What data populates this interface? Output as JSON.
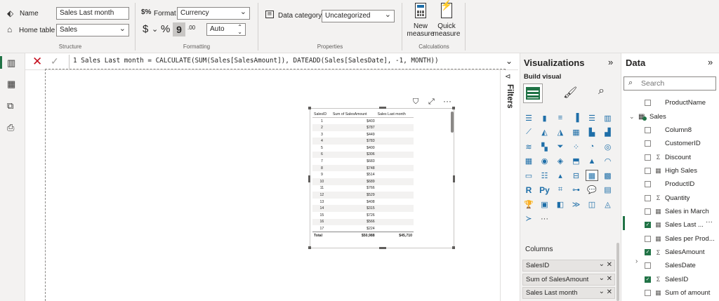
{
  "ribbon": {
    "structure": {
      "name_label": "Name",
      "name_value": "Sales Last month",
      "home_table_label": "Home table",
      "home_table_value": "Sales",
      "group_label": "Structure"
    },
    "formatting": {
      "format_label": "Format",
      "format_value": "Currency",
      "currency_symbol": "$",
      "percent_symbol": "%",
      "comma_symbol": "9",
      "decimals_symbol": ".00",
      "decimal_places_value": "Auto",
      "group_label": "Formatting"
    },
    "properties": {
      "data_category_label": "Data category",
      "data_category_value": "Uncategorized",
      "group_label": "Properties"
    },
    "calculations": {
      "new_measure_line1": "New",
      "new_measure_line2": "measure",
      "quick_measure_line1": "Quick",
      "quick_measure_line2": "measure",
      "group_label": "Calculations"
    }
  },
  "formula_bar": {
    "line_number": "1",
    "formula": "Sales Last month = CALCULATE(SUM(Sales[SalesAmount]), DATEADD(Sales[SalesDate], -1, MONTH))"
  },
  "filters_label": "Filters",
  "table_visual": {
    "headers": [
      "SalesID",
      "Sum of SalesAmount",
      "Sales Last month"
    ],
    "rows": [
      [
        "1",
        "$403",
        ""
      ],
      [
        "2",
        "$787",
        ""
      ],
      [
        "3",
        "$449",
        ""
      ],
      [
        "4",
        "$783",
        ""
      ],
      [
        "5",
        "$400",
        ""
      ],
      [
        "6",
        "$306",
        ""
      ],
      [
        "7",
        "$683",
        ""
      ],
      [
        "8",
        "$748",
        ""
      ],
      [
        "9",
        "$514",
        ""
      ],
      [
        "10",
        "$689",
        ""
      ],
      [
        "11",
        "$766",
        ""
      ],
      [
        "12",
        "$529",
        ""
      ],
      [
        "13",
        "$408",
        ""
      ],
      [
        "14",
        "$315",
        ""
      ],
      [
        "15",
        "$726",
        ""
      ],
      [
        "16",
        "$566",
        ""
      ],
      [
        "17",
        "$224",
        ""
      ]
    ],
    "total": [
      "Total",
      "$50,988",
      "$45,710"
    ]
  },
  "visualizations": {
    "title": "Visualizations",
    "build_visual_label": "Build visual",
    "more_label": "···",
    "columns_label": "Columns",
    "fields": [
      "SalesID",
      "Sum of SalesAmount",
      "Sales Last month"
    ]
  },
  "data_pane": {
    "title": "Data",
    "search_placeholder": "Search",
    "items": [
      {
        "label": "ProductName",
        "indent": 2,
        "checked": false,
        "type": "none"
      },
      {
        "label": "Sales",
        "indent": 0,
        "checked": false,
        "type": "table"
      },
      {
        "label": "Column8",
        "indent": 1,
        "checked": false,
        "type": "none"
      },
      {
        "label": "CustomerID",
        "indent": 1,
        "checked": false,
        "type": "none"
      },
      {
        "label": "Discount",
        "indent": 1,
        "checked": false,
        "type": "sum"
      },
      {
        "label": "High Sales",
        "indent": 1,
        "checked": false,
        "type": "measure"
      },
      {
        "label": "ProductID",
        "indent": 1,
        "checked": false,
        "type": "none"
      },
      {
        "label": "Quantity",
        "indent": 1,
        "checked": false,
        "type": "sum"
      },
      {
        "label": "Sales in March",
        "indent": 1,
        "checked": false,
        "type": "measure"
      },
      {
        "label": "Sales Last ...",
        "indent": 1,
        "checked": true,
        "type": "measure"
      },
      {
        "label": "Sales per Prod...",
        "indent": 1,
        "checked": false,
        "type": "measure"
      },
      {
        "label": "SalesAmount",
        "indent": 1,
        "checked": true,
        "type": "sum"
      },
      {
        "label": "SalesDate",
        "indent": 1,
        "checked": false,
        "type": "none"
      },
      {
        "label": "SalesID",
        "indent": 1,
        "checked": true,
        "type": "sum"
      },
      {
        "label": "Sum of amount",
        "indent": 1,
        "checked": false,
        "type": "measure"
      }
    ]
  }
}
